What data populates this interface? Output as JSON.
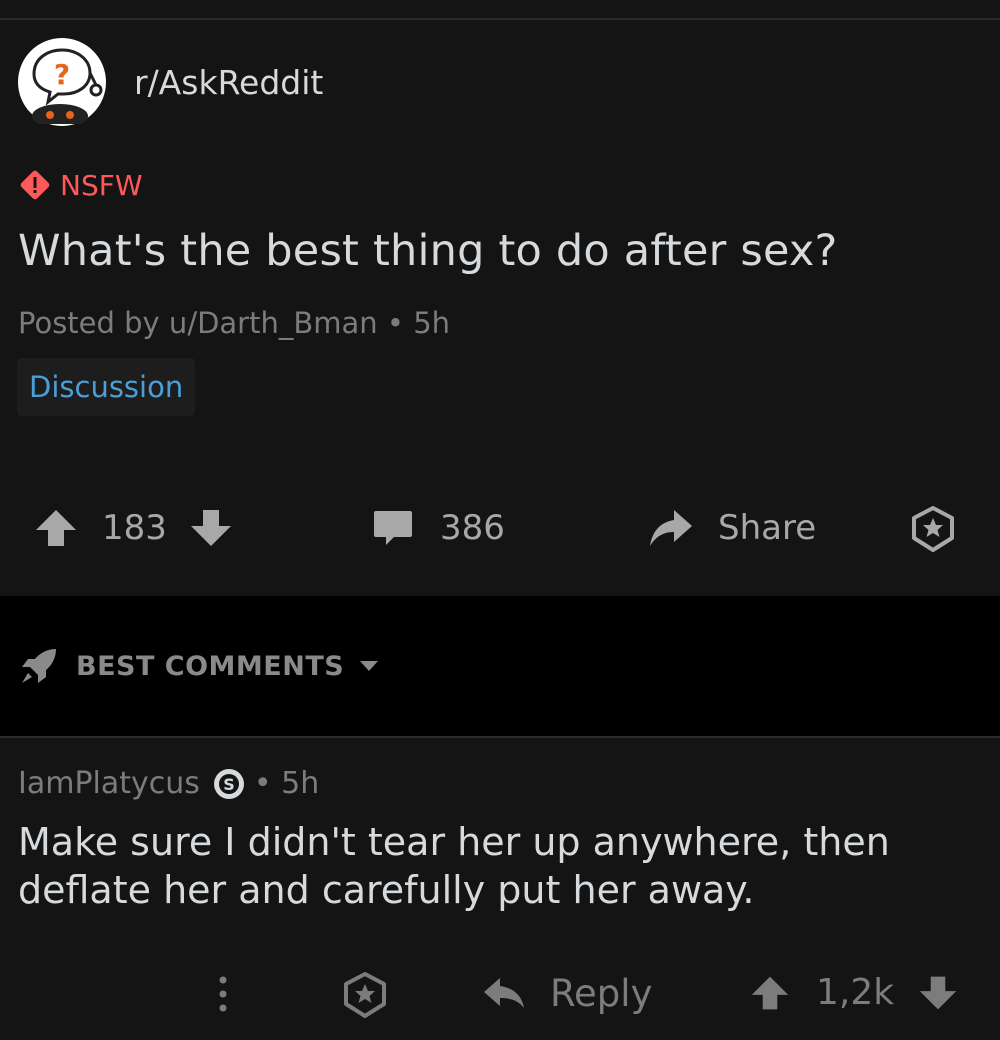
{
  "post": {
    "subreddit": "r/AskReddit",
    "nsfw_label": "NSFW",
    "title": "What's the best thing to do after sex?",
    "byline": "Posted by u/Darth_Bman • 5h",
    "flair": "Discussion",
    "score": "183",
    "comments": "386",
    "share_label": "Share"
  },
  "sort": {
    "label": "BEST COMMENTS"
  },
  "comment": {
    "author": "IamPlatycus",
    "age": "• 5h",
    "body": "Make sure I didn't tear her up anywhere, then deflate her and carefully put her away.",
    "reply_label": "Reply",
    "score": "1,2k"
  },
  "colors": {
    "background": "#141414",
    "nsfw": "#ff585b",
    "flair_text": "#4a9fd8",
    "text": "#d7dadc",
    "muted": "#7c7c7c"
  }
}
